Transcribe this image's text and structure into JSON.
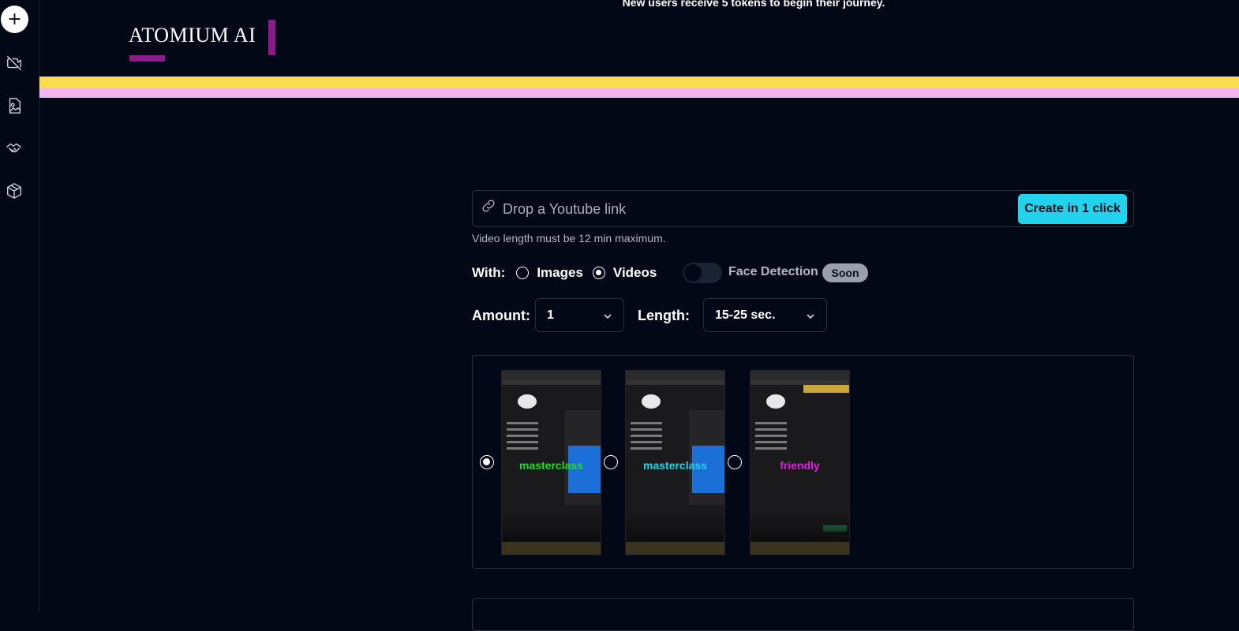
{
  "banner": {
    "text": "New users receive 5 tokens to begin their journey."
  },
  "brand": {
    "name": "ATOMIUM AI"
  },
  "sidebar": {
    "new_icon": "plus-icon",
    "items": [
      {
        "icon": "video-off-icon"
      },
      {
        "icon": "image-file-icon"
      },
      {
        "icon": "handshake-icon"
      },
      {
        "icon": "package-icon"
      }
    ]
  },
  "form": {
    "url_placeholder": "Drop a Youtube link",
    "url_value": "",
    "create_label": "Create in 1 click",
    "hint": "Video length must be 12 min maximum.",
    "with_label": "With:",
    "with_options": [
      {
        "label": "Images",
        "selected": false
      },
      {
        "label": "Videos",
        "selected": true
      }
    ],
    "face_detection_label": "Face Detection",
    "face_detection_on": false,
    "soon_badge": "Soon",
    "amount_label": "Amount:",
    "amount_value": "1",
    "length_label": "Length:",
    "length_value": "15-25 sec."
  },
  "templates": [
    {
      "caption": "masterclass",
      "caption_color": "#22dd22",
      "selected": true
    },
    {
      "caption": "masterclass",
      "caption_color": "#22d3ee",
      "selected": false
    },
    {
      "caption": "friendly",
      "caption_color": "#e01ee0",
      "selected": false
    }
  ],
  "colors": {
    "accent": "#22d3ee",
    "brand_purple": "#8b1a8b",
    "stripe_yellow": "#fcdd4f",
    "stripe_pink": "#f5b5f0",
    "background": "#030817"
  }
}
